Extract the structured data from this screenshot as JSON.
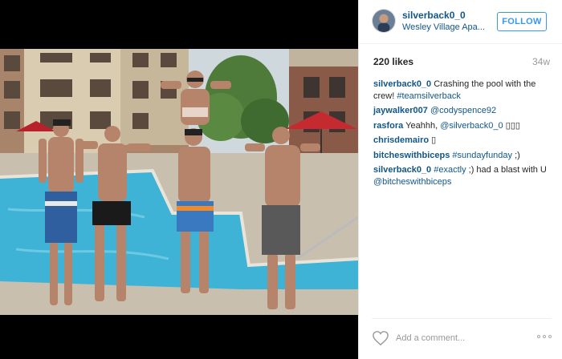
{
  "post": {
    "username": "silverback0_0",
    "location": "Wesley Village Apa...",
    "follow_label": "FOLLOW",
    "likes": "220 likes",
    "age": "34w",
    "add_comment_placeholder": "Add a comment...",
    "photo_alt": "Five people flexing by a pool",
    "icons": {
      "like": "heart-icon",
      "more": "more-options-icon"
    }
  },
  "comments": [
    {
      "user": "silverback0_0",
      "parts": [
        {
          "t": " Crashing the pool with the crew! ",
          "link": false
        },
        {
          "t": "#teamsilverback",
          "link": true
        }
      ]
    },
    {
      "user": "jaywalker007",
      "parts": [
        {
          "t": " ",
          "link": false
        },
        {
          "t": "@codyspence92",
          "link": true
        }
      ]
    },
    {
      "user": "rasfora",
      "parts": [
        {
          "t": " Yeahhh, ",
          "link": false
        },
        {
          "t": "@silverback0_0",
          "link": true
        },
        {
          "t": " ▯▯▯",
          "link": false
        }
      ]
    },
    {
      "user": "chrisdemairo",
      "parts": [
        {
          "t": " ▯",
          "link": false
        }
      ]
    },
    {
      "user": "bitcheswithbiceps",
      "parts": [
        {
          "t": " ",
          "link": false
        },
        {
          "t": "#sundayfunday",
          "link": true
        },
        {
          "t": " ;)",
          "link": false
        }
      ]
    },
    {
      "user": "silverback0_0",
      "parts": [
        {
          "t": " ",
          "link": false
        },
        {
          "t": "#exactly",
          "link": true
        },
        {
          "t": " ;) had a blast with U ",
          "link": false
        },
        {
          "t": "@bitcheswithbiceps",
          "link": true
        }
      ]
    }
  ],
  "colors": {
    "link": "#125688",
    "follow": "#3897f0",
    "muted": "#999999",
    "text": "#262626"
  }
}
